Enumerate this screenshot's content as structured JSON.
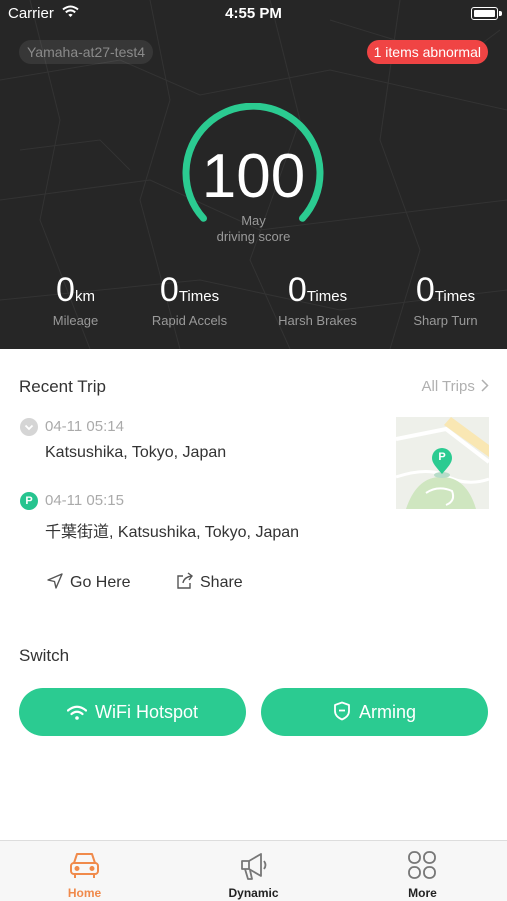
{
  "status_bar": {
    "carrier": "Carrier",
    "time": "4:55 PM"
  },
  "header": {
    "device_name": "Yamaha-at27-test4",
    "alert_badge": "1 items abnormal"
  },
  "score": {
    "value": "100",
    "month": "May",
    "label": "driving score",
    "accent_color": "#2bcb91"
  },
  "stats": [
    {
      "value": "0",
      "unit": "km",
      "label": "Mileage"
    },
    {
      "value": "0",
      "unit": "Times",
      "label": "Rapid Accels"
    },
    {
      "value": "0",
      "unit": "Times",
      "label": "Harsh Brakes"
    },
    {
      "value": "0",
      "unit": "Times",
      "label": "Sharp Turn"
    }
  ],
  "recent_trip": {
    "title": "Recent Trip",
    "all_trips_label": "All Trips",
    "start": {
      "time": "04-11 05:14",
      "address": "Katsushika, Tokyo, Japan"
    },
    "end": {
      "marker": "P",
      "time": "04-11 05:15",
      "address": "千葉街道, Katsushika, Tokyo, Japan"
    },
    "map_marker": "P",
    "actions": {
      "go_here": "Go Here",
      "share": "Share"
    }
  },
  "switch": {
    "title": "Switch",
    "wifi_label": "WiFi Hotspot",
    "arming_label": "Arming"
  },
  "tabs": [
    {
      "label": "Home",
      "active": true
    },
    {
      "label": "Dynamic",
      "active": false
    },
    {
      "label": "More",
      "active": false
    }
  ],
  "colors": {
    "active_tab": "#f08a4b",
    "accent": "#2bcb91",
    "alert": "#f04444"
  }
}
